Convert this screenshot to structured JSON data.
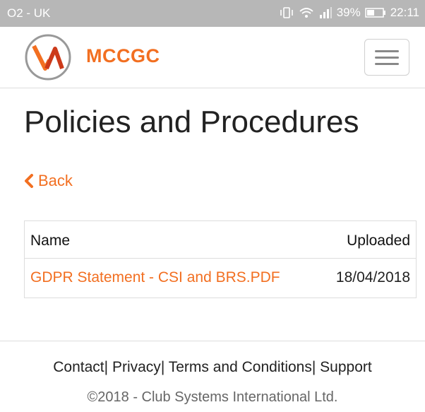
{
  "status_bar": {
    "carrier": "O2 - UK",
    "battery_percent": "39%",
    "time": "22:11"
  },
  "header": {
    "brand": "MCCGC",
    "logo_letter": "M"
  },
  "page": {
    "title": "Policies and Procedures",
    "back_label": "Back"
  },
  "table": {
    "columns": [
      "Name",
      "Uploaded"
    ],
    "rows": [
      {
        "name": "GDPR Statement - CSI and BRS.PDF",
        "uploaded": "18/04/2018"
      }
    ]
  },
  "footer": {
    "links": [
      "Contact",
      "Privacy",
      "Terms and Conditions",
      "Support"
    ],
    "separator": "|",
    "copyright": "©2018 - Club Systems International Ltd."
  },
  "colors": {
    "accent": "#f26f21",
    "status_bar": "#b7b7b7"
  }
}
